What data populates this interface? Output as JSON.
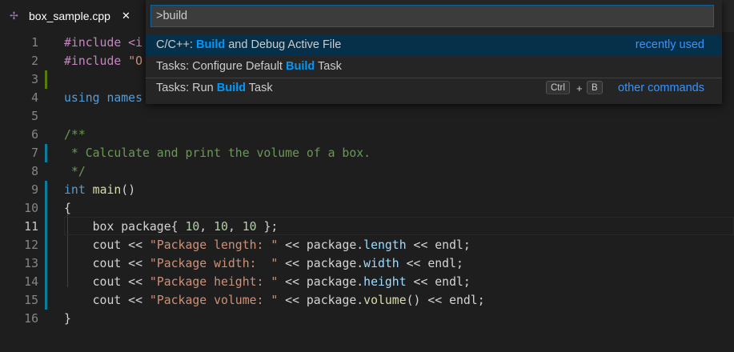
{
  "tab": {
    "icon": "cpp-file-icon",
    "title": "box_sample.cpp",
    "close": "✕"
  },
  "palette": {
    "input_value": ">build",
    "items": [
      {
        "prefix": "C/C++: ",
        "match": "Build",
        "suffix": " and Debug Active File",
        "right": "recently used"
      },
      {
        "prefix": "Tasks: Configure Default ",
        "match": "Build",
        "suffix": " Task"
      },
      {
        "prefix": "Tasks: Run ",
        "match": "Build",
        "suffix": " Task",
        "key1": "Ctrl",
        "plus": "+",
        "key2": "B",
        "right": "other commands"
      }
    ]
  },
  "editor": {
    "active_line": 11,
    "lines": [
      {
        "n": "1",
        "tokens": [
          {
            "t": "#include <i",
            "c": "pp"
          }
        ]
      },
      {
        "n": "2",
        "tokens": [
          {
            "t": "#include ",
            "c": "pp"
          },
          {
            "t": "\"O",
            "c": "str"
          }
        ]
      },
      {
        "n": "3",
        "tokens": [],
        "gutter": "add"
      },
      {
        "n": "4",
        "tokens": [
          {
            "t": "using ",
            "c": "kw"
          },
          {
            "t": "names",
            "c": "kw"
          }
        ]
      },
      {
        "n": "5",
        "tokens": []
      },
      {
        "n": "6",
        "tokens": [
          {
            "t": "/**",
            "c": "cm"
          }
        ]
      },
      {
        "n": "7",
        "tokens": [
          {
            "t": " * Calculate and print the volume of a box.",
            "c": "cm"
          }
        ],
        "gutter": "mod"
      },
      {
        "n": "8",
        "tokens": [
          {
            "t": " */",
            "c": "cm"
          }
        ]
      },
      {
        "n": "9",
        "tokens": [
          {
            "t": "int",
            "c": "kw"
          },
          {
            "t": " ",
            "c": "tx"
          },
          {
            "t": "main",
            "c": "fn"
          },
          {
            "t": "()",
            "c": "tx"
          }
        ],
        "gutter": "mod"
      },
      {
        "n": "10",
        "tokens": [
          {
            "t": "{",
            "c": "tx"
          }
        ],
        "gutter": "mod"
      },
      {
        "n": "11",
        "tokens": [
          {
            "t": "    box package{ ",
            "c": "tx"
          },
          {
            "t": "10",
            "c": "num"
          },
          {
            "t": ", ",
            "c": "tx"
          },
          {
            "t": "10",
            "c": "num"
          },
          {
            "t": ", ",
            "c": "tx"
          },
          {
            "t": "10",
            "c": "num"
          },
          {
            "t": " };",
            "c": "tx"
          }
        ],
        "gutter": "mod"
      },
      {
        "n": "12",
        "tokens": [
          {
            "t": "    cout << ",
            "c": "tx"
          },
          {
            "t": "\"Package length: \"",
            "c": "str"
          },
          {
            "t": " << package.",
            "c": "tx"
          },
          {
            "t": "length",
            "c": "mem"
          },
          {
            "t": " << endl;",
            "c": "tx"
          }
        ],
        "gutter": "mod"
      },
      {
        "n": "13",
        "tokens": [
          {
            "t": "    cout << ",
            "c": "tx"
          },
          {
            "t": "\"Package width:  \"",
            "c": "str"
          },
          {
            "t": " << package.",
            "c": "tx"
          },
          {
            "t": "width",
            "c": "mem"
          },
          {
            "t": " << endl;",
            "c": "tx"
          }
        ],
        "gutter": "mod"
      },
      {
        "n": "14",
        "tokens": [
          {
            "t": "    cout << ",
            "c": "tx"
          },
          {
            "t": "\"Package height: \"",
            "c": "str"
          },
          {
            "t": " << package.",
            "c": "tx"
          },
          {
            "t": "height",
            "c": "mem"
          },
          {
            "t": " << endl;",
            "c": "tx"
          }
        ],
        "gutter": "mod"
      },
      {
        "n": "15",
        "tokens": [
          {
            "t": "    cout << ",
            "c": "tx"
          },
          {
            "t": "\"Package volume: \"",
            "c": "str"
          },
          {
            "t": " << package.",
            "c": "tx"
          },
          {
            "t": "volume",
            "c": "fn"
          },
          {
            "t": "() << endl;",
            "c": "tx"
          }
        ],
        "gutter": "mod"
      },
      {
        "n": "16",
        "tokens": [
          {
            "t": "}",
            "c": "tx"
          }
        ]
      }
    ]
  }
}
